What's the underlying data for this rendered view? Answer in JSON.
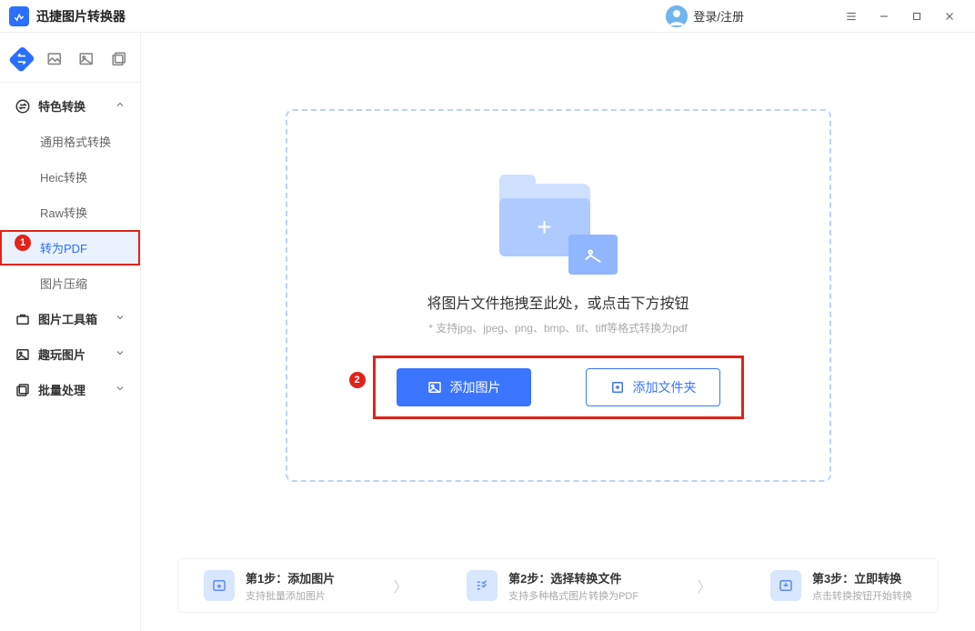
{
  "app": {
    "title": "迅捷图片转换器"
  },
  "header": {
    "user_label": "登录/注册"
  },
  "sidebar": {
    "section1": {
      "title": "特色转换",
      "items": [
        "通用格式转换",
        "Heic转换",
        "Raw转换",
        "转为PDF",
        "图片压缩"
      ]
    },
    "section2": {
      "title": "图片工具箱"
    },
    "section3": {
      "title": "趣玩图片"
    },
    "section4": {
      "title": "批量处理"
    }
  },
  "dropzone": {
    "title": "将图片文件拖拽至此处，或点击下方按钮",
    "subtitle": "* 支持jpg、jpeg、png、bmp、tif、tiff等格式转换为pdf",
    "btn_add_image": "添加图片",
    "btn_add_folder": "添加文件夹"
  },
  "steps": {
    "s1": {
      "title": "第1步：添加图片",
      "sub": "支持批量添加图片"
    },
    "s2": {
      "title": "第2步：选择转换文件",
      "sub": "支持多种格式图片转换为PDF"
    },
    "s3": {
      "title": "第3步：立即转换",
      "sub": "点击转换按钮开始转换"
    }
  },
  "annotations": {
    "m1": "1",
    "m2": "2"
  }
}
